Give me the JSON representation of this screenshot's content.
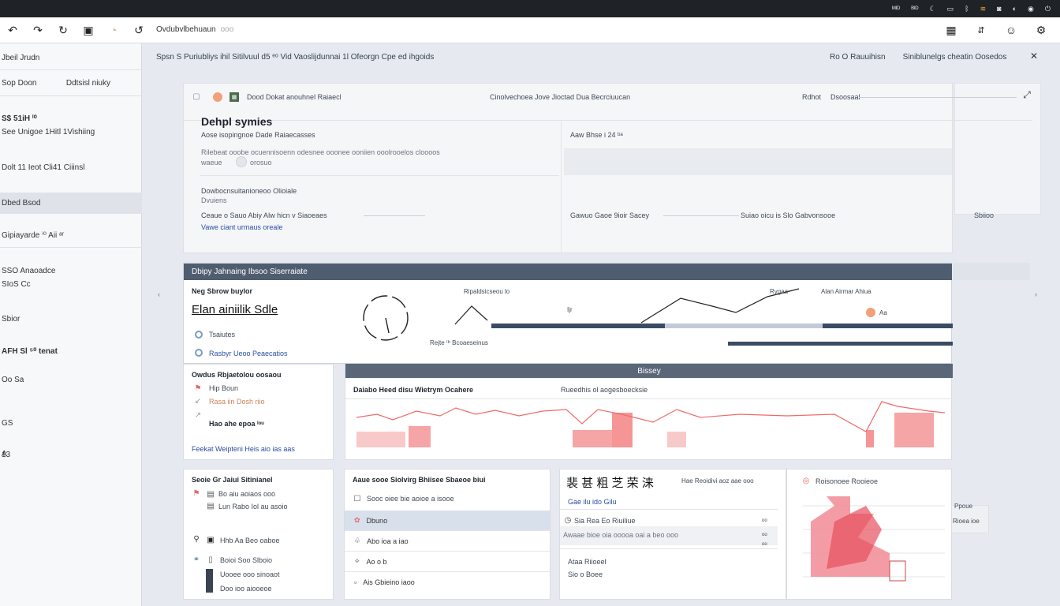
{
  "os_bar": {
    "tray": [
      "ᴹᴵᴰ",
      "ᴮᴵᴰ"
    ]
  },
  "toolbar": {
    "address": "Ovdubvlbehuaun",
    "address_hint": "ooo"
  },
  "sidebar": {
    "title": "Jbeil Jrudn",
    "filter_left": "Sop Doon",
    "filter_right": "Ddtsisl niuky",
    "items": [
      {
        "label": "S$ 51iH ⁱ⁰",
        "bold": true
      },
      {
        "label": "See Unigoe 1Hitl 1Vishiing"
      },
      {
        "label": "Dolt 11 Ieot Cli41 Ciiinsl"
      },
      {
        "label": "Dbed Bsod",
        "active": true
      },
      {
        "label": "Gipiayarde ⁱ⁰ Aii ᵃʳ"
      },
      {
        "label": "SSO Anaoadce"
      },
      {
        "label": "SIoS Cc"
      },
      {
        "label": "Sbior"
      },
      {
        "label": "AFH Sl ⁵⁰ tenat"
      },
      {
        "label": "Oo Sa"
      },
      {
        "label": "GS"
      },
      {
        "label": "A"
      },
      {
        "label": "13"
      }
    ]
  },
  "breadcrumbs": {
    "left": "Spsn S Puriubliys ihil   Sitilvuul d5 ᵉᵒ   Vid Vaoslijdunnai 1l   Ofeorgn   Cpe ed ihgoids",
    "right_a": "Ro O Rauuihisn",
    "right_b": "Siniblunelgs cheatin Oosedos"
  },
  "top_card": {
    "header_left": "Dood Dokat anouhnel Raiaecl",
    "header_center": "Cinolvechoea Jove Jioctad Dua Becrciuucan",
    "header_right_a": "Rdhot",
    "header_right_b": "Dsoosaal",
    "title": "Dehpl symies",
    "subtitle": "Aose isopingnoe Dade Raiaecasses",
    "desc": "Rilebeat ooobe ocuennisoenn odesnee ooonee ooniien ooolrooelos cloooos",
    "desc2": "waeue",
    "toggle_label": "orosuo",
    "field1": "Dowbocnsuitanioneoo Olioiale",
    "field1b": "Dvuiens",
    "field2": "Ceaue o Sauo Abiy Alw hicn v Siaoeaes",
    "field3": "Vawe ciant urmaus oreale",
    "right_sub": "Aaw Bhse i 24 ᵇᵃ",
    "row_a": "Gawuo Gaoe 9ioir Sacey",
    "row_b": "Suiao oicu is Slo Gabvonsooe",
    "row_c": "Sbiioo"
  },
  "analytics": {
    "header": "Dbipy Jahnaing Ibsoo Siserraiate",
    "metric_title": "Neg Sbrow buylor",
    "metric_value": "Elan ainiilik Sdle",
    "legend1": "Tsaiutes",
    "legend2": "Rasbyr Ueoo Peaecatios",
    "chart_label_a": "Ripaldsicseou lo",
    "chart_label_b": "Wesibsaise ar",
    "chart_mid": "Ijr",
    "chart_right": "Rygaa",
    "chart_right2": "Alan Airmar Ahiua",
    "chart_point": "Aa",
    "chart_foot": "Rejte ⁽ᵇ Bcoaeseinus"
  },
  "mid_left": {
    "title": "Owdus Rbjaetolou oosaou",
    "rows": [
      "Hip Boun",
      "Rasa iin  Dosh riio",
      "Hao ahe epoa  ⁱᵒᵘ"
    ],
    "footer": "Feekat Weipteni Heis aio ias aas"
  },
  "trend": {
    "header": "Bissey",
    "left_label": "Daiabo Heed disu Wietrym Ocahere",
    "right_label": "Rueedhis ol aogesboecksie"
  },
  "card_a": {
    "title": "Seoie Gr Jaiui Sitinianel",
    "rows": [
      "Bo aiu aoiaos ooo",
      "Lun Rabo Iol au asoio",
      "Hhb Aa Beo oaboe",
      "Boioi Soo Slboio",
      "Uooee ooo sinoaot",
      "Doo ioo aiooeoe"
    ]
  },
  "card_b": {
    "title": "Aaue sooe Siolvirg Bhiisee Sbaeoe biui",
    "rows": [
      {
        "label": "Sooc oiee bie aoioe a isooe",
        "sel": false
      },
      {
        "label": "Dbuno",
        "sel": true
      },
      {
        "label": "Abo ioa a iao",
        "sel": false
      },
      {
        "label": "Ao o b",
        "sel": false
      },
      {
        "label": "Ais Gbieino iaoo",
        "sel": false
      }
    ]
  },
  "card_c": {
    "title": "裴 甚 粗 芝 荣 涞",
    "title_tail": "Hae Reoidivi aoz aae ooo",
    "row1": "Gae ilu ido Gilu",
    "row2": "Sia Rea Eo Riuiliue",
    "row3": "Awaae bioe oia ooooa oai a beo ooo",
    "row4": "Ataa Riioeel",
    "row5": "Sio o Boee"
  },
  "card_d": {
    "title": "Roisonoee Rooieoe",
    "side_a": "Ppoue",
    "side_b": "Rioea ioe"
  },
  "colors": {
    "accent": "#f26b6b",
    "header_dark": "#4f5d70",
    "navy_bar": "#3a4b64"
  }
}
